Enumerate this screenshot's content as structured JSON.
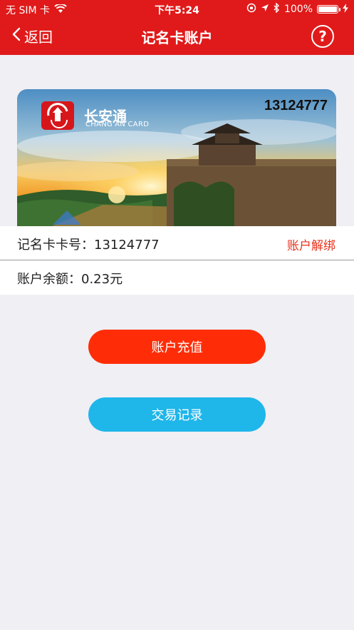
{
  "status_bar": {
    "carrier": "无 SIM 卡",
    "time": "下午5:24",
    "battery": "100%"
  },
  "nav": {
    "back_label": "返回",
    "title": "记名卡账户",
    "help_glyph": "?"
  },
  "card": {
    "number": "13124777",
    "brand": "长安通",
    "brand_en": "CHANG'AN CARD"
  },
  "account": {
    "card_no_label": "记名卡卡号：13124777",
    "unbind_label": "账户解绑",
    "balance_label": "账户余额：0.23元"
  },
  "actions": {
    "recharge_label": "账户充值",
    "records_label": "交易记录"
  },
  "colors": {
    "header": "#e01a1a",
    "recharge": "#ff2d07",
    "records": "#1fb6ea",
    "unbind": "#e6321b"
  }
}
